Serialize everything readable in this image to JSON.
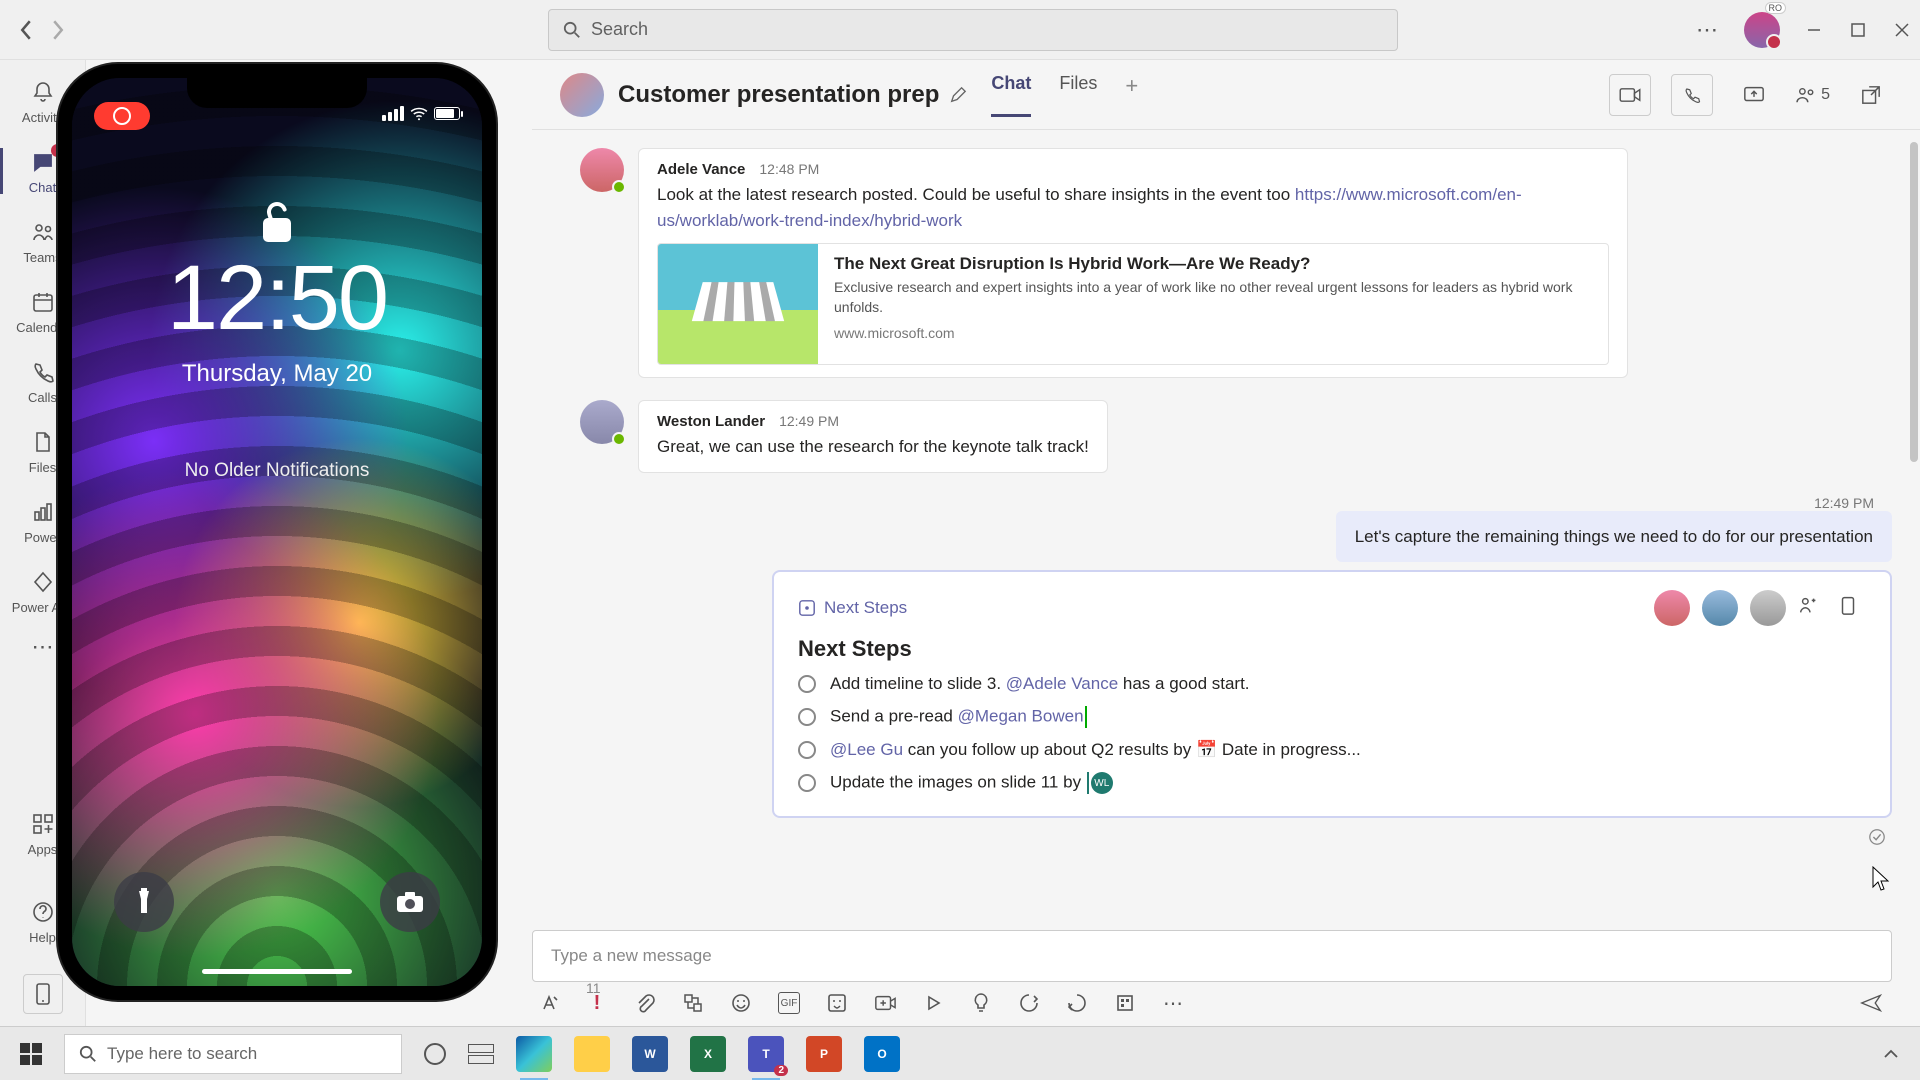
{
  "titlebar": {
    "search_placeholder": "Search",
    "avatar_initials": "RO"
  },
  "rail": {
    "items": [
      {
        "label": "Activity",
        "icon": "bell"
      },
      {
        "label": "Chat",
        "icon": "chat",
        "active": true,
        "badge": ""
      },
      {
        "label": "Teams",
        "icon": "teams"
      },
      {
        "label": "Calendar",
        "icon": "calendar"
      },
      {
        "label": "Calls",
        "icon": "calls"
      },
      {
        "label": "Files",
        "icon": "files"
      },
      {
        "label": "Power",
        "icon": "power"
      },
      {
        "label": "Power A…",
        "icon": "powera"
      }
    ],
    "apps_label": "Apps",
    "help_label": "Help"
  },
  "chat_header": {
    "title": "Customer presentation prep",
    "tabs": {
      "chat": "Chat",
      "files": "Files"
    },
    "participant_count": "5"
  },
  "messages": {
    "m1": {
      "sender": "Adele Vance",
      "time": "12:48 PM",
      "text_before_link": "Look at the latest research posted. Could be useful to share insights in the event too ",
      "link_text": "https://www.microsoft.com/en-us/worklab/work-trend-index/hybrid-work",
      "card": {
        "title": "The Next Great Disruption Is Hybrid Work—Are We Ready?",
        "desc": "Exclusive research and expert insights into a year of work like no other reveal urgent lessons for leaders as hybrid work unfolds.",
        "domain": "www.microsoft.com"
      }
    },
    "m2": {
      "sender": "Weston Lander",
      "time": "12:49 PM",
      "text": "Great, we can use the research for the keynote talk track!"
    },
    "m3": {
      "time": "12:49 PM",
      "text": "Let's capture the remaining things we need to do for our presentation"
    },
    "loop": {
      "breadcrumb": "Next Steps",
      "title": "Next Steps",
      "items": [
        {
          "pre": "Add timeline to slide 3. ",
          "mention": "@Adele Vance",
          "post": " has a good start."
        },
        {
          "pre": "Send a pre-read ",
          "mention": "@Megan Bowen",
          "post": ""
        },
        {
          "pre": "",
          "mention": "@Lee Gu",
          "post": " can you follow up about Q2 results by 📅 Date in progress..."
        },
        {
          "pre": "Update the images on slide 11 by ",
          "mention": "",
          "post": ""
        }
      ],
      "wl_initials": "WL"
    }
  },
  "compose": {
    "placeholder": "Type a new message"
  },
  "phone": {
    "time": "12:50",
    "date": "Thursday, May 20",
    "notification_text": "No Older Notifications"
  },
  "taskbar": {
    "search_placeholder": "Type here to search",
    "teams_badge": "2"
  },
  "chat_list_visible_right_edge": {
    "last_visible_time": "11"
  }
}
